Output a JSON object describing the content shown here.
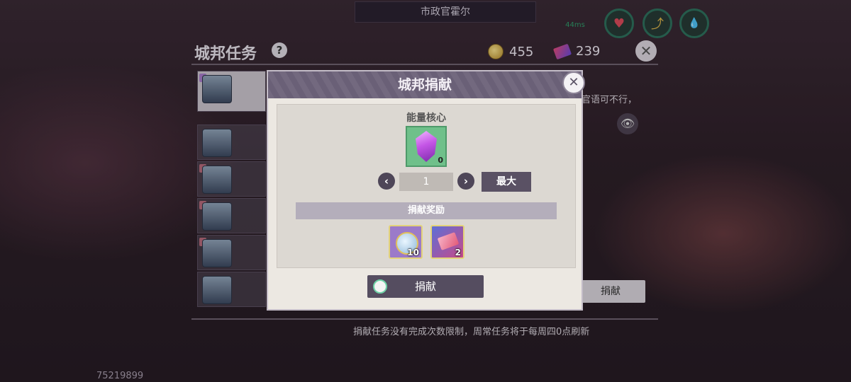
{
  "header": {
    "title": "市政官霍尔",
    "signal_text": "44ms"
  },
  "status_icons": [
    {
      "icon": "heart-icon",
      "glyph": "♥"
    },
    {
      "icon": "swap-icon",
      "glyph": "⤴"
    },
    {
      "icon": "water-drop-icon",
      "glyph": "💧"
    }
  ],
  "panel": {
    "title": "城邦任务",
    "help": "?",
    "coins": "455",
    "tickets": "239",
    "close": "✕",
    "hint_right": "官语可不行，",
    "bg_donate_label": "捐献",
    "footer_note": "捐献任务没有完成次数限制，周常任务将于每周四0点刷新",
    "uid": "75219899"
  },
  "modal": {
    "title": "城邦捐献",
    "close": "✕",
    "item_name": "能量核心",
    "item_count": "0",
    "prev": "‹",
    "next": "›",
    "quantity": "1",
    "max_label": "最大",
    "rewards_label": "捐献奖励",
    "rewards": [
      {
        "icon": "coin-icon",
        "count": "10"
      },
      {
        "icon": "ticket-icon",
        "count": "2"
      }
    ],
    "donate_label": "捐献"
  }
}
